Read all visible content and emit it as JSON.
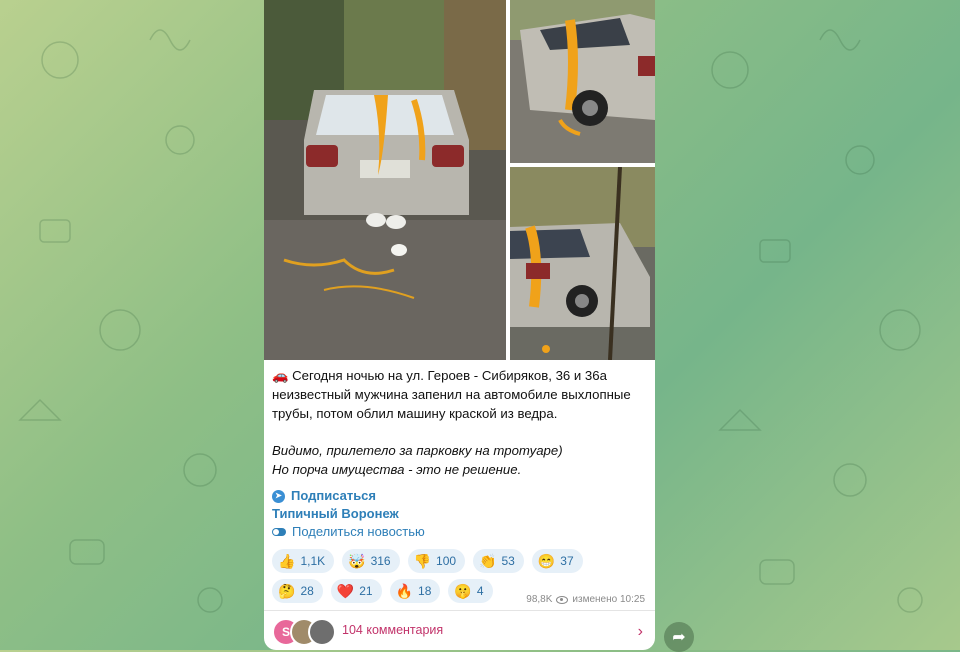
{
  "post": {
    "text_line1_emoji": "🚗",
    "text_para1": "Сегодня ночью на ул. Героев - Сибиряков, 36 и 36а неизвестный мужчина запенил на автомобиле выхлопные трубы, потом облил машину краской из ведра.",
    "text_para2_line1": "Видимо, прилетело за парковку на тротуаре)",
    "text_para2_line2": "Но порча имущества - это не решение.",
    "subscribe_label": "Подписаться",
    "channel_name": "Типичный Воронеж",
    "share_news_label": "Поделиться новостью",
    "reactions": [
      {
        "emoji": "👍",
        "count": "1,1K"
      },
      {
        "emoji": "🤯",
        "count": "316"
      },
      {
        "emoji": "👎",
        "count": "100"
      },
      {
        "emoji": "👏",
        "count": "53"
      },
      {
        "emoji": "😁",
        "count": "37"
      },
      {
        "emoji": "🤔",
        "count": "28"
      },
      {
        "emoji": "❤️",
        "count": "21"
      },
      {
        "emoji": "🔥",
        "count": "18"
      },
      {
        "emoji": "🤫",
        "count": "4"
      }
    ],
    "views": "98,8K",
    "edited_time": "изменено 10:25",
    "comments_label": "104 комментария",
    "avatar_letter": "S"
  },
  "icons": {
    "telegram": "telegram-icon",
    "toggle": "toggle-icon",
    "eye": "eye-icon",
    "chevron": "chevron-right-icon",
    "share": "share-arrow-icon"
  },
  "colors": {
    "link": "#2e7fb8",
    "reaction_bg": "#e6f0f8",
    "comments_accent": "#c2336a",
    "paint": "#f0a21a"
  }
}
